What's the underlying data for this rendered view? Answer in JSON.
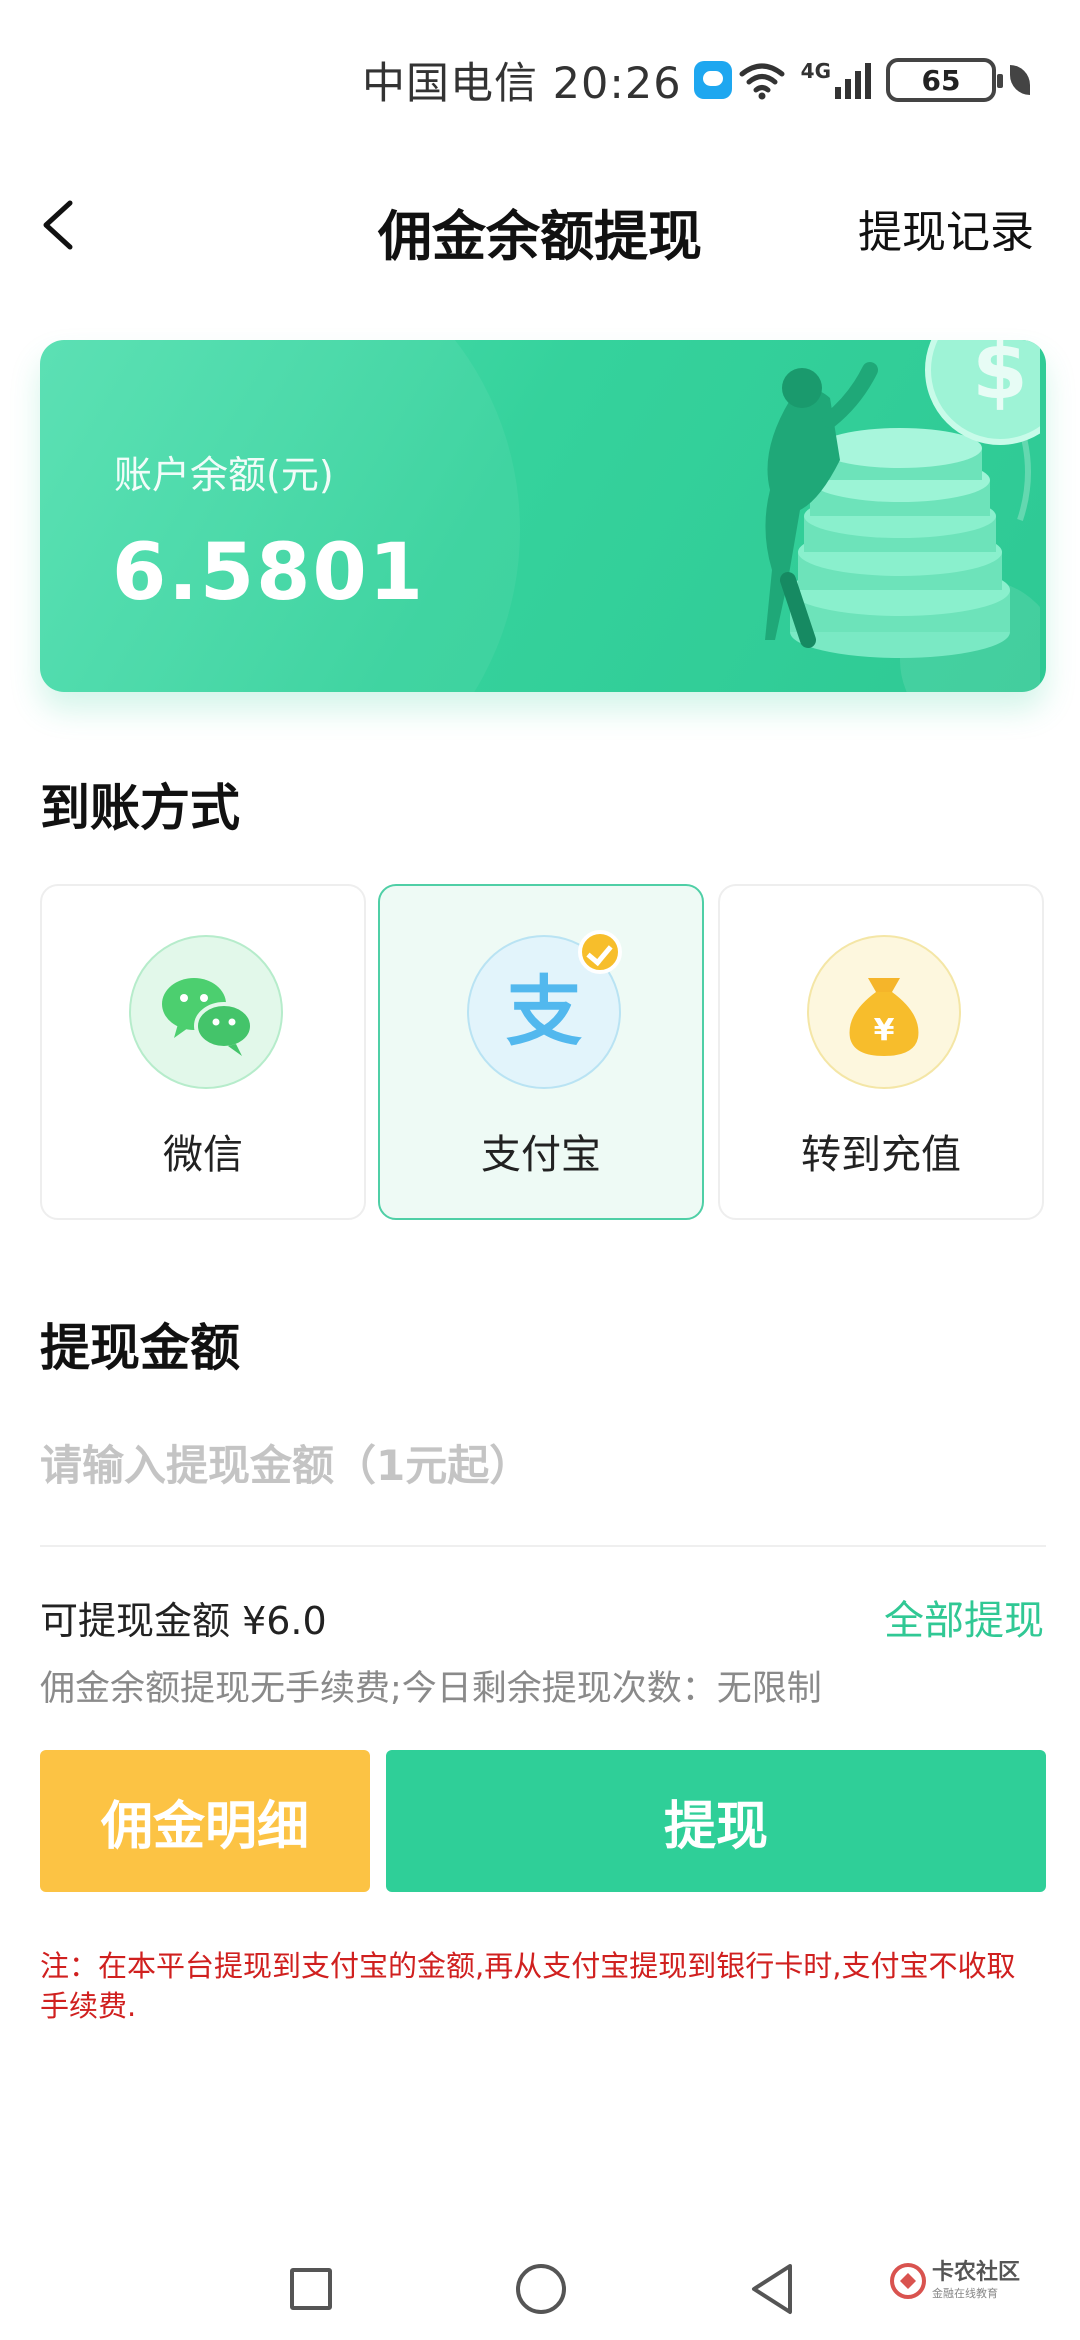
{
  "status_bar": {
    "carrier_time": "中国电信 20:26",
    "network": "4G",
    "battery": "65"
  },
  "header": {
    "title": "佣金余额提现",
    "record_link": "提现记录"
  },
  "balance_card": {
    "label": "账户余额(元)",
    "value": "6.5801"
  },
  "payout": {
    "section_title": "到账方式",
    "methods": [
      {
        "label": "微信",
        "icon": "wechat-icon",
        "selected": false
      },
      {
        "label": "支付宝",
        "icon": "alipay-icon",
        "selected": true
      },
      {
        "label": "转到充值",
        "icon": "money-bag-icon",
        "selected": false
      }
    ],
    "alipay_glyph": "支",
    "yuan_glyph": "¥"
  },
  "amount": {
    "section_title": "提现金额",
    "placeholder": "请输入提现金额（1元起）",
    "available_text": "可提现金额 ¥6.0",
    "withdraw_all": "全部提现",
    "fee_note": "佣金余额提现无手续费;今日剩余提现次数：无限制"
  },
  "buttons": {
    "detail": "佣金明细",
    "withdraw": "提现"
  },
  "notice": "注：在本平台提现到支付宝的金额,再从支付宝提现到银行卡时,支付宝不收取手续费.",
  "watermark": {
    "title": "卡农社区",
    "subtitle": "金融在线教育"
  },
  "colors": {
    "accent_green": "#2fcf98",
    "accent_yellow": "#fcc344",
    "notice_red": "#d0201f"
  }
}
